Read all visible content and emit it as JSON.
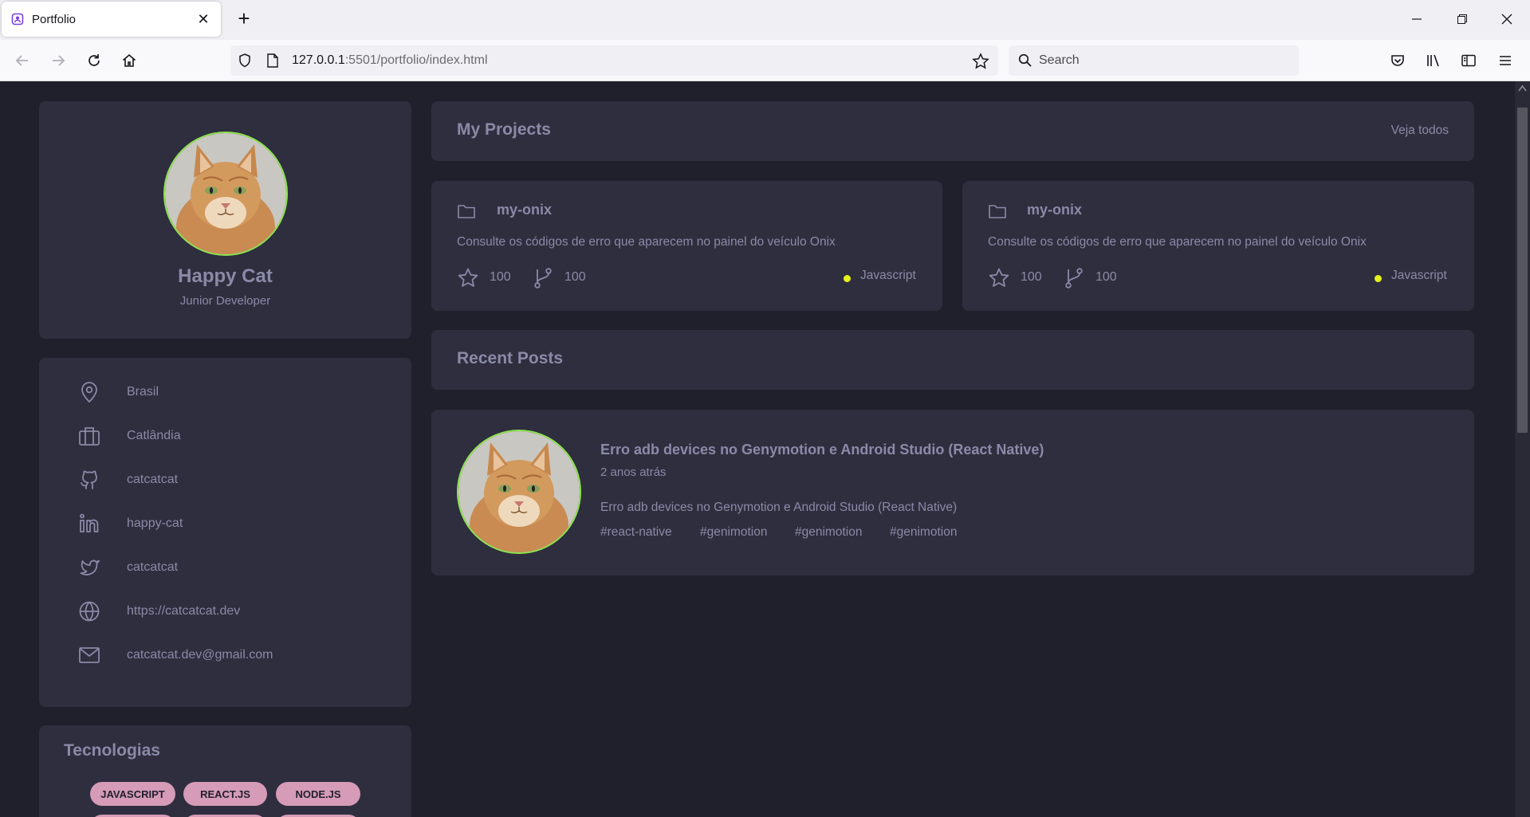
{
  "browser": {
    "tab_title": "Portfolio",
    "url_host": "127.0.0.1",
    "url_rest": ":5501/portfolio/index.html",
    "search_placeholder": "Search"
  },
  "profile": {
    "name": "Happy Cat",
    "role": "Junior Developer"
  },
  "info": {
    "country": "Brasil",
    "company": "Catlândia",
    "github": "catcatcat",
    "linkedin": "happy-cat",
    "twitter": "catcatcat",
    "website": "https://catcatcat.dev",
    "email": "catcatcat.dev@gmail.com"
  },
  "tech": {
    "title": "Tecnologias",
    "tags": [
      "JAVASCRIPT",
      "REACT.JS",
      "NODE.JS"
    ]
  },
  "projects": {
    "title": "My Projects",
    "see_all": "Veja todos",
    "items": [
      {
        "name": "my-onix",
        "description": "Consulte os códigos de erro que aparecem no painel do veículo Onix",
        "stars": "100",
        "forks": "100",
        "language": "Javascript"
      },
      {
        "name": "my-onix",
        "description": "Consulte os códigos de erro que aparecem no painel do veículo Onix",
        "stars": "100",
        "forks": "100",
        "language": "Javascript"
      }
    ]
  },
  "posts": {
    "title": "Recent Posts",
    "items": [
      {
        "title": "Erro adb devices no Genymotion e Android Studio (React Native)",
        "time": "2 anos atrás",
        "body": "Erro adb devices no Genymotion e Android Studio (React Native)",
        "tags": [
          "#react-native",
          "#genimotion",
          "#genimotion",
          "#genimotion"
        ]
      }
    ]
  },
  "colors": {
    "page_bg": "#20202c",
    "card_bg": "#2e2e3e",
    "text_muted": "#8a8aa8",
    "avatar_ring": "#8ee34f",
    "lang_dot": "#e6f21a",
    "tag_bg": "#d59bb7"
  }
}
